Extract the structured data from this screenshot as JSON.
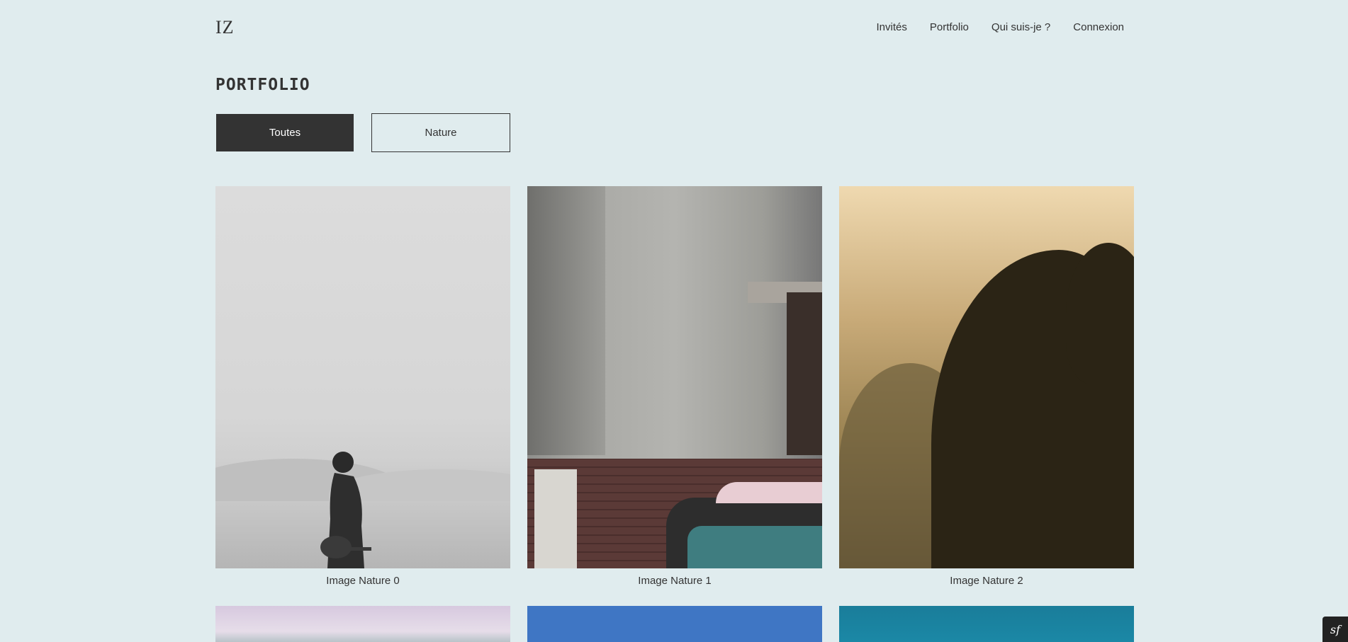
{
  "header": {
    "logo": "IZ",
    "nav": [
      "Invités",
      "Portfolio",
      "Qui suis-je ?",
      "Connexion"
    ]
  },
  "page": {
    "title": "PORTFOLIO"
  },
  "filters": {
    "items": [
      "Toutes",
      "Nature"
    ],
    "active": "Toutes"
  },
  "gallery": {
    "items": [
      {
        "caption": "Image Nature 0",
        "icon": "desert-silhouette-photo"
      },
      {
        "caption": "Image Nature 1",
        "icon": "old-wall-car-photo"
      },
      {
        "caption": "Image Nature 2",
        "icon": "foggy-trees-photo"
      }
    ]
  },
  "toolbar": {
    "badge_label": "sf"
  }
}
